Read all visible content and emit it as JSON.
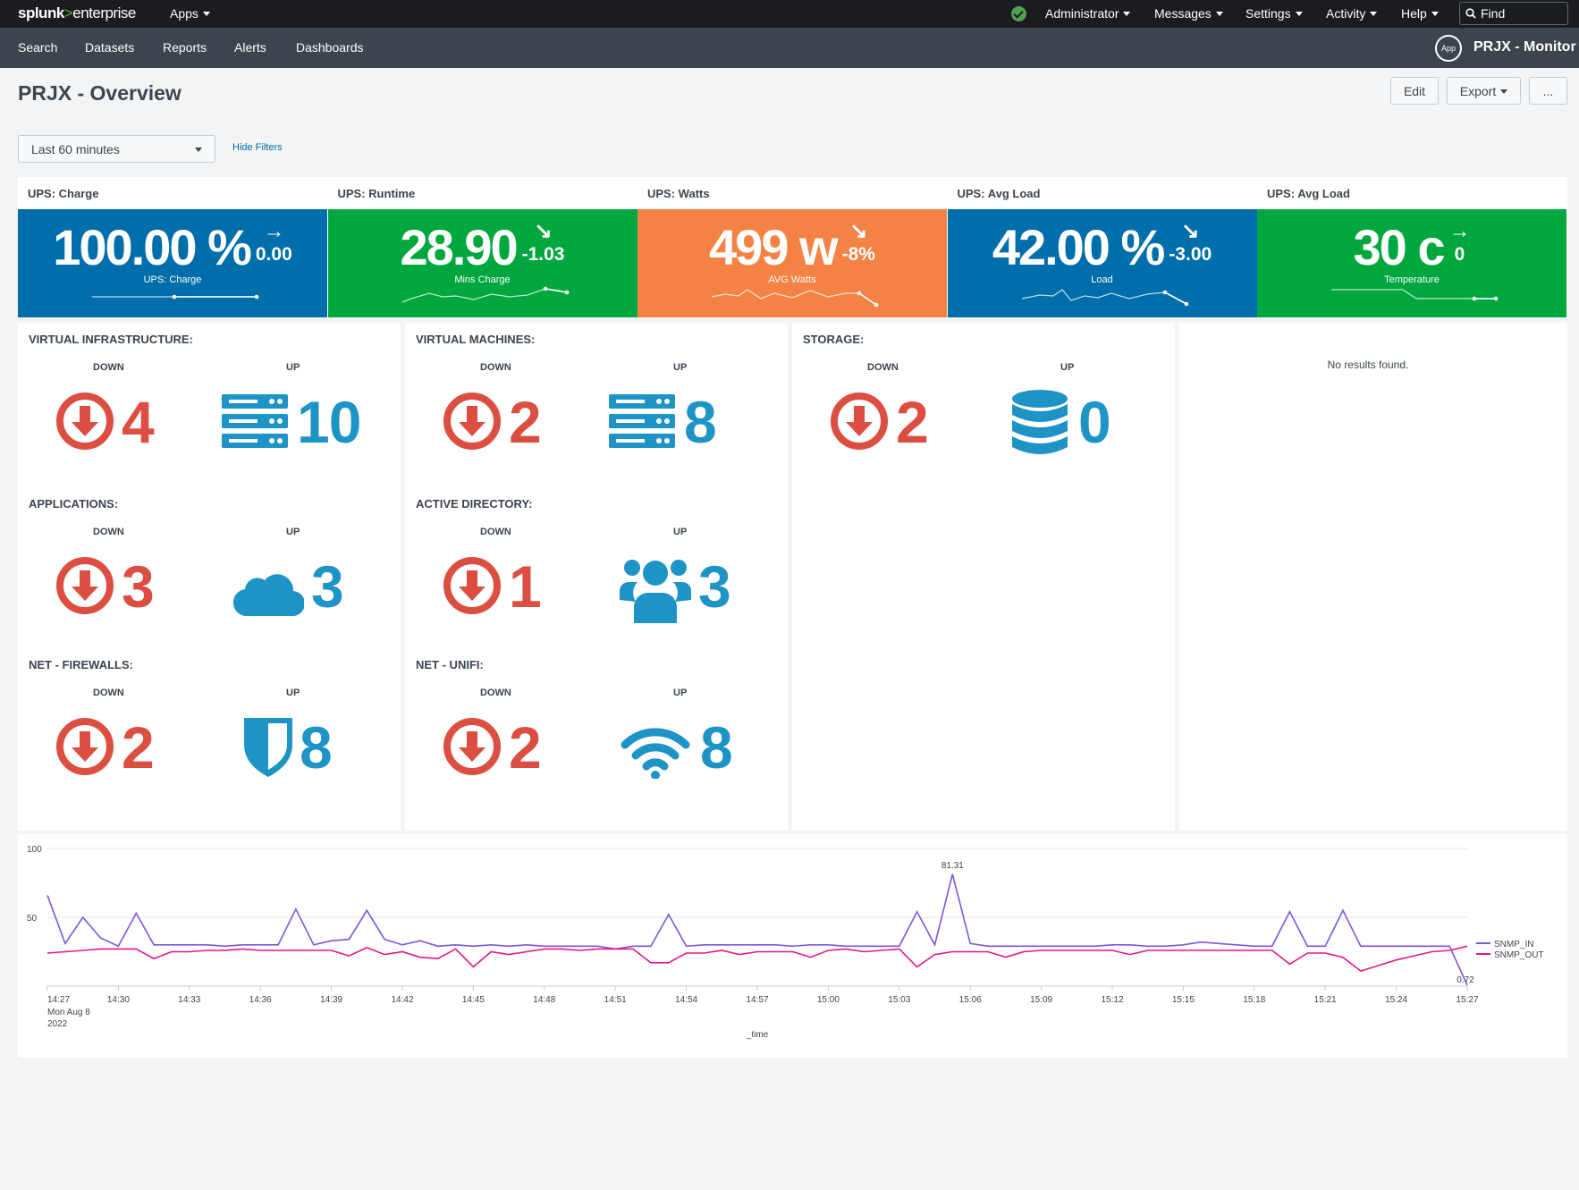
{
  "topbar": {
    "logo_a": "splunk",
    "logo_b": ">",
    "logo_c": "enterprise",
    "apps": "Apps",
    "administrator": "Administrator",
    "messages": "Messages",
    "settings": "Settings",
    "activity": "Activity",
    "help": "Help",
    "find_placeholder": "Find",
    "status_color": "#53a051"
  },
  "appbar": {
    "search": "Search",
    "datasets": "Datasets",
    "reports": "Reports",
    "alerts": "Alerts",
    "dashboards": "Dashboards",
    "app_badge": "App",
    "app_title": "PRJX - Monitor"
  },
  "page": {
    "title": "PRJX - Overview",
    "edit": "Edit",
    "export": "Export",
    "more": "...",
    "time_range": "Last 60 minutes",
    "hide_filters": "Hide Filters"
  },
  "ups": [
    {
      "title": "UPS: Charge",
      "value": "100.00 %",
      "arrow": "→",
      "delta": "0.00",
      "under": "UPS: Charge",
      "color": "#006eaa"
    },
    {
      "title": "UPS: Runtime",
      "value": "28.90",
      "arrow": "↘",
      "delta": "-1.03",
      "under": "Mins Charge",
      "color": "#00a73e"
    },
    {
      "title": "UPS: Watts",
      "value": "499 w",
      "arrow": "↘",
      "delta": "-8%",
      "under": "AVG Watts",
      "color": "#f48244"
    },
    {
      "title": "UPS: Avg Load",
      "value": "42.00 %",
      "arrow": "↘",
      "delta": "-3.00",
      "under": "Load",
      "color": "#006eaa"
    },
    {
      "title": "UPS: Avg Load",
      "value": "30 c",
      "arrow": "→",
      "delta": "0",
      "under": "Temperature",
      "color": "#00a73e"
    }
  ],
  "labels": {
    "down": "DOWN",
    "up": "UP"
  },
  "status_panels": {
    "virtual_infrastructure": {
      "title": "VIRTUAL INFRASTRUCTURE:",
      "down": "4",
      "up": "10",
      "up_icon": "server-icon"
    },
    "virtual_machines": {
      "title": "VIRTUAL MACHINES:",
      "down": "2",
      "up": "8",
      "up_icon": "server-icon"
    },
    "storage": {
      "title": "STORAGE:",
      "down": "2",
      "up": "0",
      "up_icon": "database-icon"
    },
    "applications": {
      "title": "APPLICATIONS:",
      "down": "3",
      "up": "3",
      "up_icon": "cloud-icon"
    },
    "active_directory": {
      "title": "ACTIVE DIRECTORY:",
      "down": "1",
      "up": "3",
      "up_icon": "users-icon"
    },
    "net_firewalls": {
      "title": "NET - FIREWALLS:",
      "down": "2",
      "up": "8",
      "up_icon": "shield-icon"
    },
    "net_unifi": {
      "title": "NET - UNIFI:",
      "down": "2",
      "up": "8",
      "up_icon": "wifi-icon"
    }
  },
  "no_results": "No results found.",
  "colors": {
    "down": "#dc4e41",
    "up": "#1e93c6"
  },
  "chart_data": {
    "type": "line",
    "xlabel": "_time",
    "ylabel": "",
    "ylim": [
      0,
      100
    ],
    "yticks": [
      "100",
      "50"
    ],
    "x_ticks": [
      "14:27",
      "14:30",
      "14:33",
      "14:36",
      "14:39",
      "14:42",
      "14:45",
      "14:48",
      "14:51",
      "14:54",
      "14:57",
      "15:00",
      "15:03",
      "15:06",
      "15:09",
      "15:12",
      "15:15",
      "15:18",
      "15:21",
      "15:24",
      "15:27"
    ],
    "x_first_sub1": "Mon Aug 8",
    "x_first_sub2": "2022",
    "annotations": [
      "81.31",
      "0.72"
    ],
    "series": [
      {
        "name": "SNMP_IN",
        "color": "#7b56db",
        "values": [
          66,
          31,
          50,
          35,
          29,
          53,
          30,
          30,
          30,
          30,
          29,
          30,
          30,
          30,
          56,
          30,
          33,
          34,
          55,
          34,
          30,
          33,
          29,
          30,
          29,
          30,
          29,
          30,
          29,
          29,
          29,
          29,
          27,
          29,
          29,
          52,
          29,
          30,
          30,
          30,
          30,
          30,
          29,
          30,
          30,
          29,
          29,
          29,
          29,
          54,
          30,
          81.31,
          31,
          29,
          29,
          29,
          29,
          29,
          29,
          29,
          30,
          30,
          29,
          29,
          30,
          32,
          31,
          30,
          29,
          29,
          54,
          29,
          29,
          55,
          29,
          29,
          29,
          29,
          29,
          29,
          0.72
        ]
      },
      {
        "name": "SNMP_OUT",
        "color": "#e6158b",
        "values": [
          24,
          25,
          26,
          27,
          27,
          27,
          20,
          25,
          25,
          26,
          26,
          27,
          26,
          26,
          26,
          26,
          26,
          22,
          28,
          23,
          25,
          21,
          20,
          27,
          14,
          25,
          23,
          25,
          27,
          27,
          26,
          27,
          27,
          27,
          17,
          17,
          24,
          24,
          26,
          23,
          25,
          25,
          25,
          21,
          26,
          27,
          25,
          26,
          27,
          14,
          23,
          25,
          25,
          25,
          21,
          25,
          26,
          26,
          26,
          26,
          26,
          23,
          26,
          26,
          26,
          26,
          26,
          26,
          26,
          26,
          16,
          24,
          24,
          21,
          11,
          15,
          19,
          22,
          25,
          26,
          29
        ]
      }
    ]
  }
}
